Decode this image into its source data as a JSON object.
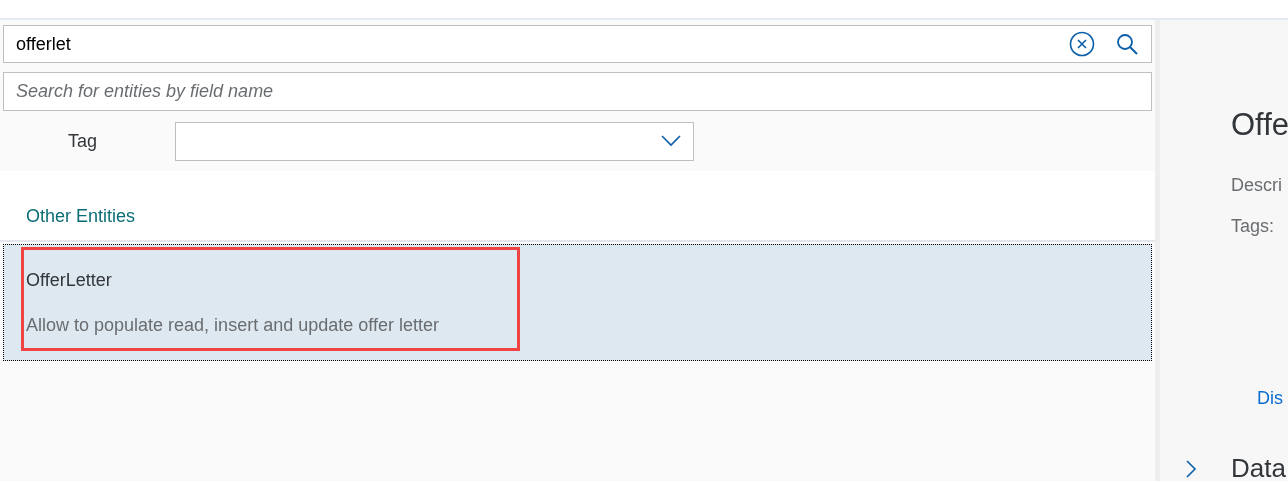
{
  "search": {
    "value": "offerlet"
  },
  "field_search": {
    "placeholder": "Search for entities by field name"
  },
  "tag_filter": {
    "label": "Tag"
  },
  "section": {
    "title": "Other Entities"
  },
  "results": [
    {
      "name": "OfferLetter",
      "description": "Allow to populate read, insert and update offer letter",
      "selected": true,
      "highlighted": true
    }
  ],
  "detail": {
    "title": "Offe",
    "description_label": "Descri",
    "tags_label": "Tags:",
    "link": "Dis",
    "section": {
      "title": "Data",
      "expanded": false
    }
  }
}
